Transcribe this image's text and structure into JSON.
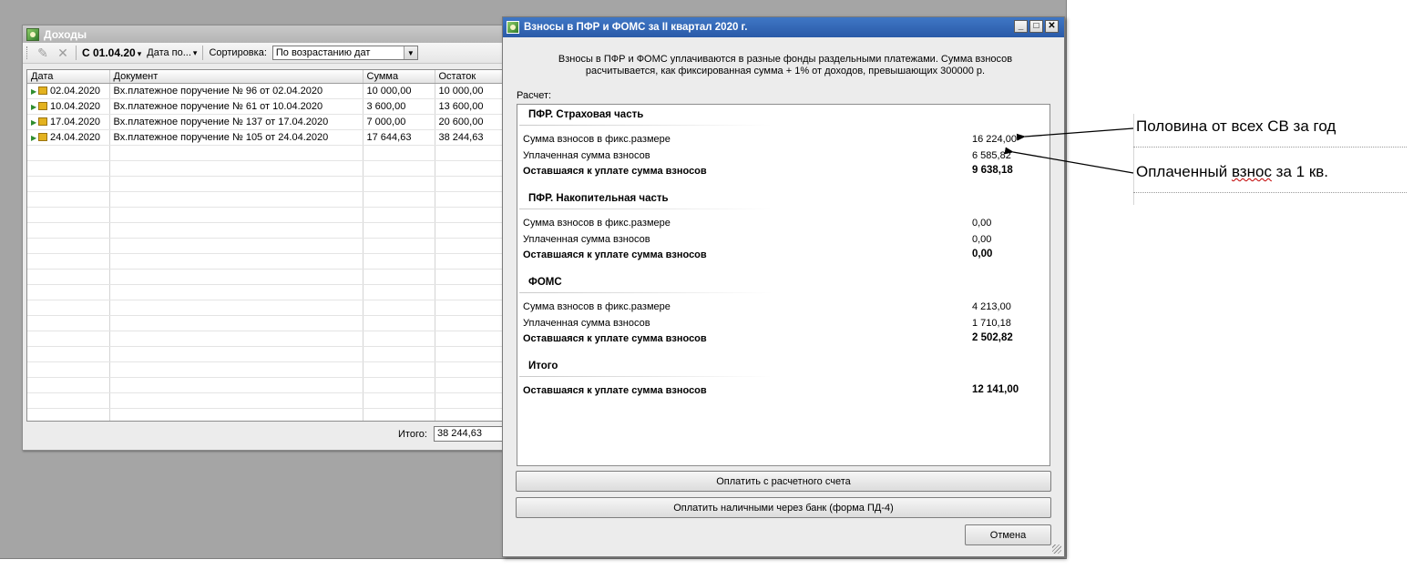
{
  "income": {
    "title": "Доходы",
    "toolbar": {
      "period": "С 01.04.20",
      "date_to": "Дата по...",
      "sort_label": "Сортировка:",
      "sort_value": "По возрастанию дат"
    },
    "columns": [
      "Дата",
      "Документ",
      "Сумма",
      "Остаток"
    ],
    "rows": [
      {
        "date": "02.04.2020",
        "doc": "Вх.платежное поручение № 96 от 02.04.2020",
        "sum": "10 000,00",
        "rest": "10 000,00"
      },
      {
        "date": "10.04.2020",
        "doc": "Вх.платежное поручение № 61 от 10.04.2020",
        "sum": "3 600,00",
        "rest": "13 600,00"
      },
      {
        "date": "17.04.2020",
        "doc": "Вх.платежное поручение № 137 от 17.04.2020",
        "sum": "7 000,00",
        "rest": "20 600,00"
      },
      {
        "date": "24.04.2020",
        "doc": "Вх.платежное поручение № 105 от 24.04.2020",
        "sum": "17 644,63",
        "rest": "38 244,63"
      }
    ],
    "total_label": "Итого:",
    "total_value": "38 244,63"
  },
  "dialog": {
    "title": "Взносы в ПФР и ФОМС за II квартал 2020 г.",
    "desc_line1": "Взносы в ПФР и ФОМС уплачиваются в разные фонды раздельными платежами. Сумма взносов",
    "desc_line2": "расчитывается, как фиксированная сумма + 1% от доходов, превышающих 300000 р.",
    "calc_label": "Расчет:",
    "sections": [
      {
        "title": "ПФР. Страховая часть",
        "fixed_label": "Сумма взносов в фикс.размере",
        "fixed_value": "16 224,00",
        "paid_label": "Уплаченная сумма взносов",
        "paid_value": "6 585,82",
        "due_label": "Оставшаяся к уплате сумма взносов",
        "due_value": "9 638,18"
      },
      {
        "title": "ПФР. Накопительная часть",
        "fixed_label": "Сумма взносов в фикс.размере",
        "fixed_value": "0,00",
        "paid_label": "Уплаченная сумма взносов",
        "paid_value": "0,00",
        "due_label": "Оставшаяся к уплате сумма взносов",
        "due_value": "0,00"
      },
      {
        "title": "ФОМС",
        "fixed_label": "Сумма взносов в фикс.размере",
        "fixed_value": "4 213,00",
        "paid_label": "Уплаченная сумма взносов",
        "paid_value": "1 710,18",
        "due_label": "Оставшаяся к уплате сумма взносов",
        "due_value": "2 502,82"
      }
    ],
    "total_title": "Итого",
    "total_label": "Оставшаяся к уплате сумма взносов",
    "total_value": "12 141,00",
    "btn_pay_account": "Оплатить с расчетного счета",
    "btn_pay_cash": "Оплатить наличными через банк (форма ПД-4)",
    "btn_cancel": "Отмена"
  },
  "annotations": {
    "note1": "Половина от всех СВ за год",
    "note2_a": "Оплаченный ",
    "note2_b": "взнос",
    "note2_c": " за 1 кв."
  }
}
